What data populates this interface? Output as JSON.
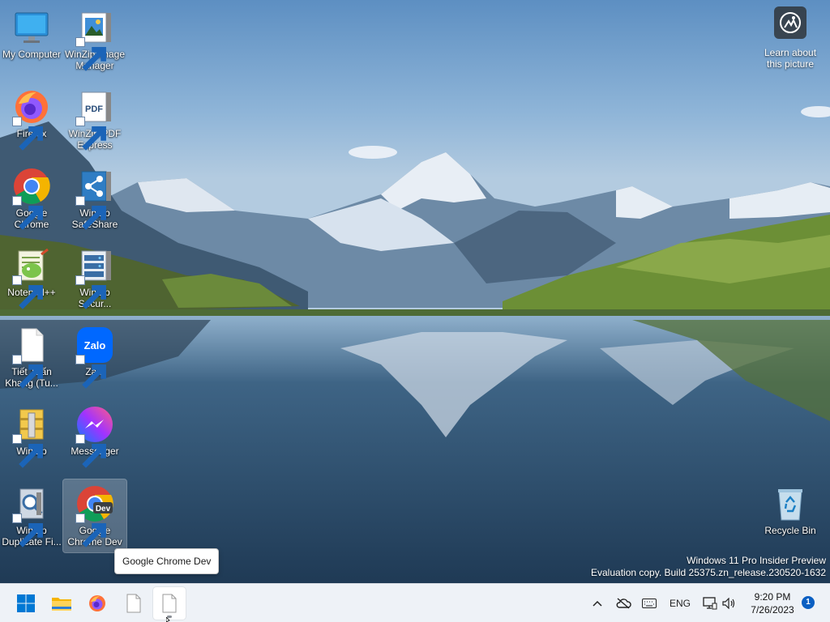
{
  "desktop": {
    "icons": [
      {
        "label": "My Computer"
      },
      {
        "label": "WinZip Image Manager"
      },
      {
        "label": "Firefox"
      },
      {
        "label": "WinZip PDF Express"
      },
      {
        "label": "Google Chrome"
      },
      {
        "label": "WinZip SafeShare"
      },
      {
        "label": "Notepad++"
      },
      {
        "label": "WinZip Secur..."
      },
      {
        "label": "Tiết Tuấn Khang (Tu..."
      },
      {
        "label": "Zalo"
      },
      {
        "label": "WinZip"
      },
      {
        "label": "Messenger"
      },
      {
        "label": "WinZip Duplicate Fi..."
      },
      {
        "label": "Google Chrome Dev"
      }
    ],
    "recycle_bin": {
      "label": "Recycle Bin"
    },
    "learn": {
      "label": "Learn about this picture"
    },
    "pdf_badge": "PDF",
    "zalo_badge": "Zalo",
    "chrome_dev_badge": "Dev"
  },
  "watermark": {
    "line1": "Windows 11 Pro Insider Preview",
    "line2": "Evaluation copy. Build 25375.zn_release.230520-1632"
  },
  "tooltip": {
    "text": "Google Chrome Dev"
  },
  "taskbar": {
    "apps": [
      {
        "icon": "windows-start-icon"
      },
      {
        "icon": "file-explorer-icon"
      },
      {
        "icon": "firefox-icon"
      },
      {
        "icon": "blank-document-icon"
      },
      {
        "icon": "blank-document-icon"
      }
    ],
    "tray": {
      "language": "ENG",
      "time": "9:20 PM",
      "date": "7/26/2023",
      "notification_count": "1"
    }
  },
  "colors": {
    "taskbar_bg": "#eef2f7",
    "accent": "#0a5fc2"
  }
}
